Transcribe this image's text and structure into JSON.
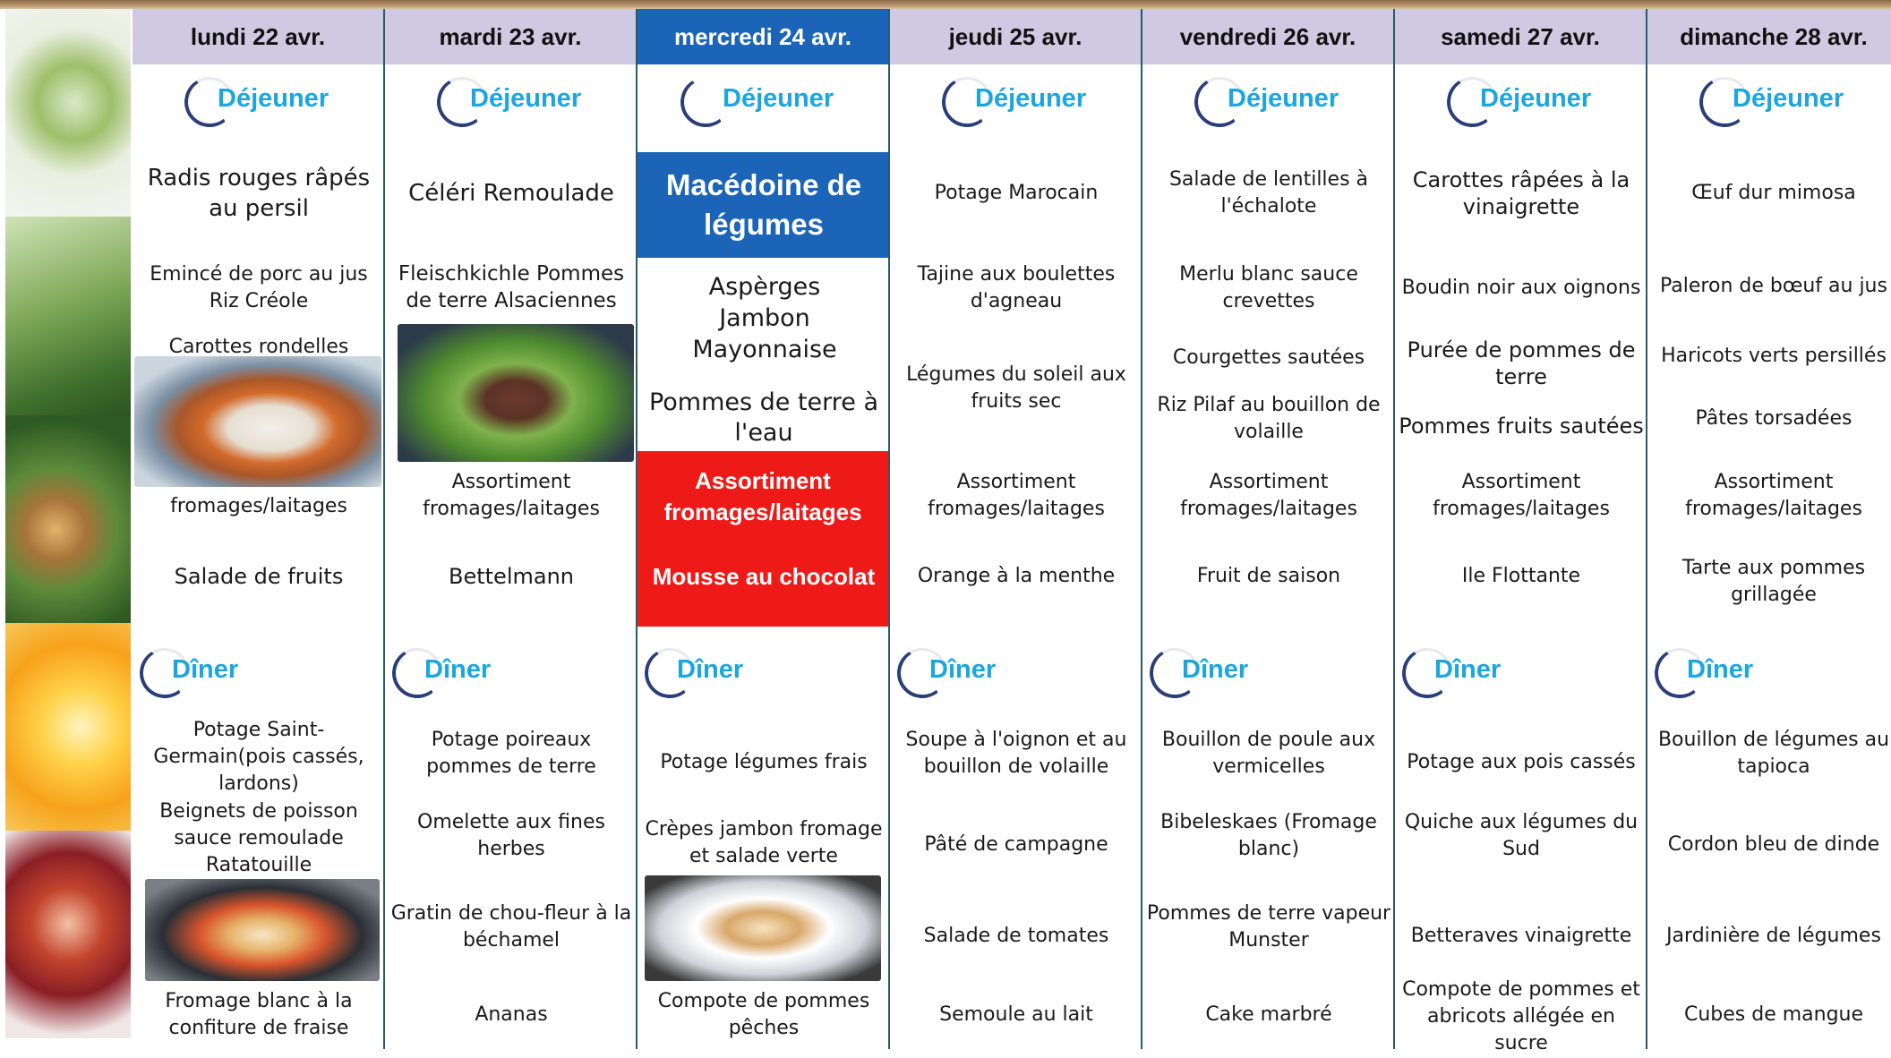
{
  "labels": {
    "lunch": "Déjeuner",
    "dinner": "Dîner"
  },
  "colors": {
    "header_bg": "#cfc9e2",
    "today_blue": "#1b64b8",
    "today_red": "#ee1a18",
    "meal_label": "#1aa6e0"
  },
  "days": [
    {
      "name": "lundi 22 avr.",
      "lunch": [
        "Radis rouges râpés au persil",
        "Emincé de porc au jus Riz Créole",
        "Carottes rondelles",
        "fromages/laitages",
        "Salade de fruits"
      ],
      "dinner": [
        "Potage Saint-Germain(pois cassés, lardons)",
        "Beignets de poisson sauce remoulade Ratatouille",
        "Fromage blanc à la confiture de fraise"
      ]
    },
    {
      "name": "mardi 23 avr.",
      "lunch": [
        "Céléri Remoulade",
        "Fleischkichle Pommes de terre Alsaciennes",
        "Assortiment fromages/laitages",
        "Bettelmann"
      ],
      "dinner": [
        "Potage poireaux pommes de terre",
        "Omelette aux fines herbes",
        "Gratin de chou-fleur à la béchamel",
        "Ananas"
      ]
    },
    {
      "name": "mercredi 24 avr.",
      "lunch": [
        "Macédoine de légumes",
        "Aspèrges Jambon Mayonnaise",
        "Pommes de terre à l'eau",
        "Assortiment fromages/laitages",
        "Mousse au chocolat"
      ],
      "dinner": [
        "Potage légumes frais",
        "Crèpes jambon fromage et salade verte",
        "Compote de pommes pêches"
      ]
    },
    {
      "name": "jeudi 25 avr.",
      "lunch": [
        "Potage Marocain",
        "Tajine aux boulettes d'agneau",
        "Légumes du soleil aux fruits sec",
        "Assortiment fromages/laitages",
        "Orange à la menthe"
      ],
      "dinner": [
        "Soupe à l'oignon et au bouillon de volaille",
        "Pâté de campagne",
        "Salade de tomates",
        "Semoule au lait"
      ]
    },
    {
      "name": "vendredi 26 avr.",
      "lunch": [
        "Salade de lentilles à l'échalote",
        "Merlu blanc sauce crevettes",
        "Courgettes sautées",
        "Riz Pilaf au bouillon de volaille",
        "Assortiment fromages/laitages",
        "Fruit de saison"
      ],
      "dinner": [
        "Bouillon de poule aux vermicelles",
        "Bibeleskaes (Fromage blanc)",
        "Pommes de terre vapeur Munster",
        "Cake marbré"
      ]
    },
    {
      "name": "samedi 27 avr.",
      "lunch": [
        "Carottes râpées à la vinaigrette",
        "Boudin noir aux oignons",
        "Purée de pommes de terre",
        "Pommes fruits sautées",
        "Assortiment fromages/laitages",
        "Ile Flottante"
      ],
      "dinner": [
        "Potage aux pois cassés",
        "Quiche aux légumes du Sud",
        "Betteraves vinaigrette",
        "Compote de pommes et abricots allégée en sucre"
      ]
    },
    {
      "name": "dimanche 28 avr.",
      "lunch": [
        "Œuf dur mimosa",
        "Paleron de bœuf au jus",
        "Haricots verts persillés",
        "Pâtes torsadées",
        "Assortiment fromages/laitages",
        "Tarte aux pommes grillagée"
      ],
      "dinner": [
        "Bouillon de légumes au tapioca",
        "Cordon bleu de dinde",
        "Jardinière de légumes",
        "Cubes de mangue"
      ]
    }
  ]
}
